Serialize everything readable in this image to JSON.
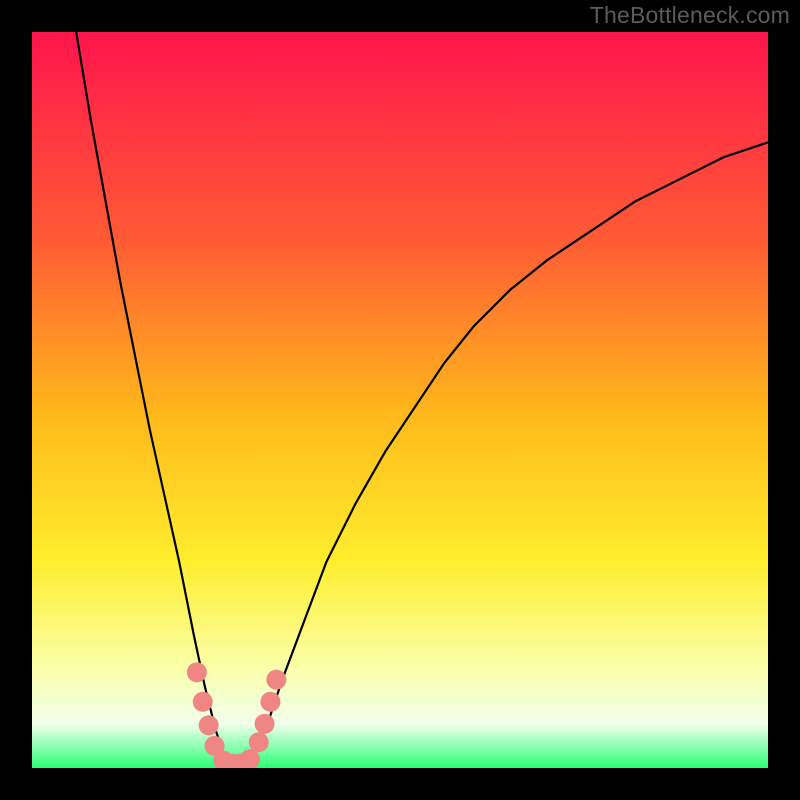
{
  "watermark": "TheBottleneck.com",
  "colors": {
    "frame": "#000000",
    "grad_top": "#ff154c",
    "grad_mid1": "#ff5a35",
    "grad_mid2": "#ffb91a",
    "grad_mid3": "#ffee2d",
    "grad_mid4": "#faffa5",
    "grad_mid5": "#f1ffec",
    "grad_bottom": "#2aff75",
    "curve": "#000000",
    "marker": "#ef8683"
  },
  "chart_data": {
    "type": "line",
    "title": "",
    "xlabel": "",
    "ylabel": "",
    "xlim": [
      0,
      100
    ],
    "ylim": [
      0,
      100
    ],
    "series": [
      {
        "name": "bottleneck-curve",
        "x": [
          6,
          8,
          10,
          12,
          14,
          16,
          18,
          20,
          22,
          23.5,
          25,
          26,
          27,
          28.5,
          30,
          32,
          34,
          37,
          40,
          44,
          48,
          52,
          56,
          60,
          65,
          70,
          76,
          82,
          88,
          94,
          100
        ],
        "y": [
          100,
          88,
          77,
          66,
          56,
          46,
          37,
          28,
          18,
          11,
          5,
          2,
          0.6,
          0.6,
          2,
          6,
          12,
          20,
          28,
          36,
          43,
          49,
          55,
          60,
          65,
          69,
          73,
          77,
          80,
          83,
          85
        ]
      }
    ],
    "markers": {
      "name": "highlight-points",
      "points": [
        {
          "x": 22.4,
          "y": 13.0
        },
        {
          "x": 23.2,
          "y": 9.0
        },
        {
          "x": 24.0,
          "y": 5.8
        },
        {
          "x": 24.8,
          "y": 3.0
        },
        {
          "x": 26.0,
          "y": 1.0
        },
        {
          "x": 27.2,
          "y": 0.6
        },
        {
          "x": 28.4,
          "y": 0.6
        },
        {
          "x": 29.6,
          "y": 1.2
        },
        {
          "x": 30.8,
          "y": 3.5
        },
        {
          "x": 31.6,
          "y": 6.0
        },
        {
          "x": 32.4,
          "y": 9.0
        },
        {
          "x": 33.2,
          "y": 12.0
        }
      ]
    }
  }
}
